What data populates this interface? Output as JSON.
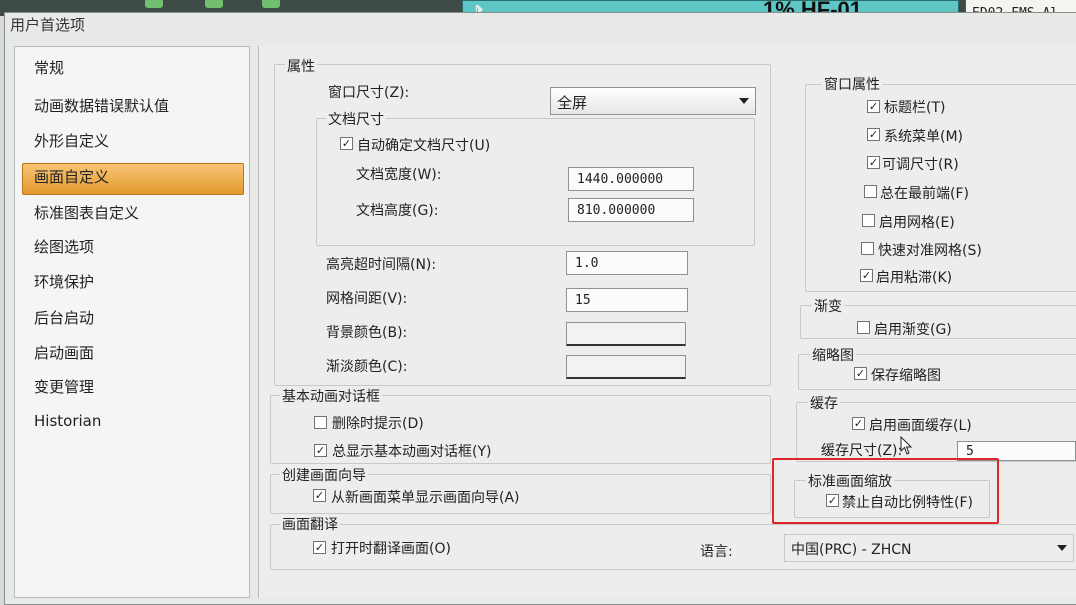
{
  "background": {
    "teal_panel_text": "1% HF-01",
    "external_window_text": "ED02_FMS_Al"
  },
  "dialog": {
    "title": "用户首选项"
  },
  "nav": {
    "items": [
      "常规",
      "动画数据错误默认值",
      "外形自定义",
      "画面自定义",
      "标准图表自定义",
      "绘图选项",
      "环境保护",
      "后台启动",
      "启动画面",
      "变更管理",
      "Historian"
    ],
    "selected_index": 3
  },
  "properties": {
    "group_title": "属性",
    "window_size_label": "窗口尺寸(Z):",
    "window_size_value": "全屏",
    "doc_size_group": "文档尺寸",
    "auto_doc_size_label": "自动确定文档尺寸(U)",
    "auto_doc_size_checked": true,
    "doc_width_label": "文档宽度(W):",
    "doc_width_value": "1440.000000",
    "doc_height_label": "文档高度(G):",
    "doc_height_value": "810.000000",
    "highlight_timeout_label": "高亮超时间隔(N):",
    "highlight_timeout_value": "1.0",
    "grid_spacing_label": "网格间距(V):",
    "grid_spacing_value": "15",
    "bg_color_label": "背景颜色(B):",
    "fade_color_label": "渐淡颜色(C):"
  },
  "basic_anim": {
    "title": "基本动画对话框",
    "delete_prompt_label": "删除时提示(D)",
    "delete_prompt_checked": false,
    "always_show_label": "总显示基本动画对话框(Y)",
    "always_show_checked": true
  },
  "wizard": {
    "title": "创建画面向导",
    "show_wizard_label": "从新画面菜单显示画面向导(A)",
    "show_wizard_checked": true
  },
  "translate": {
    "title": "画面翻译",
    "translate_on_open_label": "打开时翻译画面(O)",
    "translate_on_open_checked": true,
    "language_label": "语言:",
    "language_value": "中国(PRC) - ZHCN"
  },
  "window_props": {
    "title": "窗口属性",
    "items": [
      {
        "label": "标题栏(T)",
        "checked": true
      },
      {
        "label": "系统菜单(M)",
        "checked": true
      },
      {
        "label": "可调尺寸(R)",
        "checked": true
      },
      {
        "label": "总在最前端(F)",
        "checked": false
      },
      {
        "label": "启用网格(E)",
        "checked": false
      },
      {
        "label": "快速对准网格(S)",
        "checked": false
      },
      {
        "label": "启用粘滞(K)",
        "checked": true
      }
    ]
  },
  "fade": {
    "title": "渐变",
    "enable_label": "启用渐变(G)",
    "enable_checked": false
  },
  "thumbnail": {
    "title": "缩略图",
    "save_label": "保存缩略图",
    "save_checked": true
  },
  "cache": {
    "title": "缓存",
    "enable_label": "启用画面缓存(L)",
    "enable_checked": true,
    "size_label": "缓存尺寸(Z):",
    "size_value": "5"
  },
  "scaling": {
    "title": "标准画面缩放",
    "disable_label": "禁止自动比例特性(F)",
    "disable_checked": true
  }
}
